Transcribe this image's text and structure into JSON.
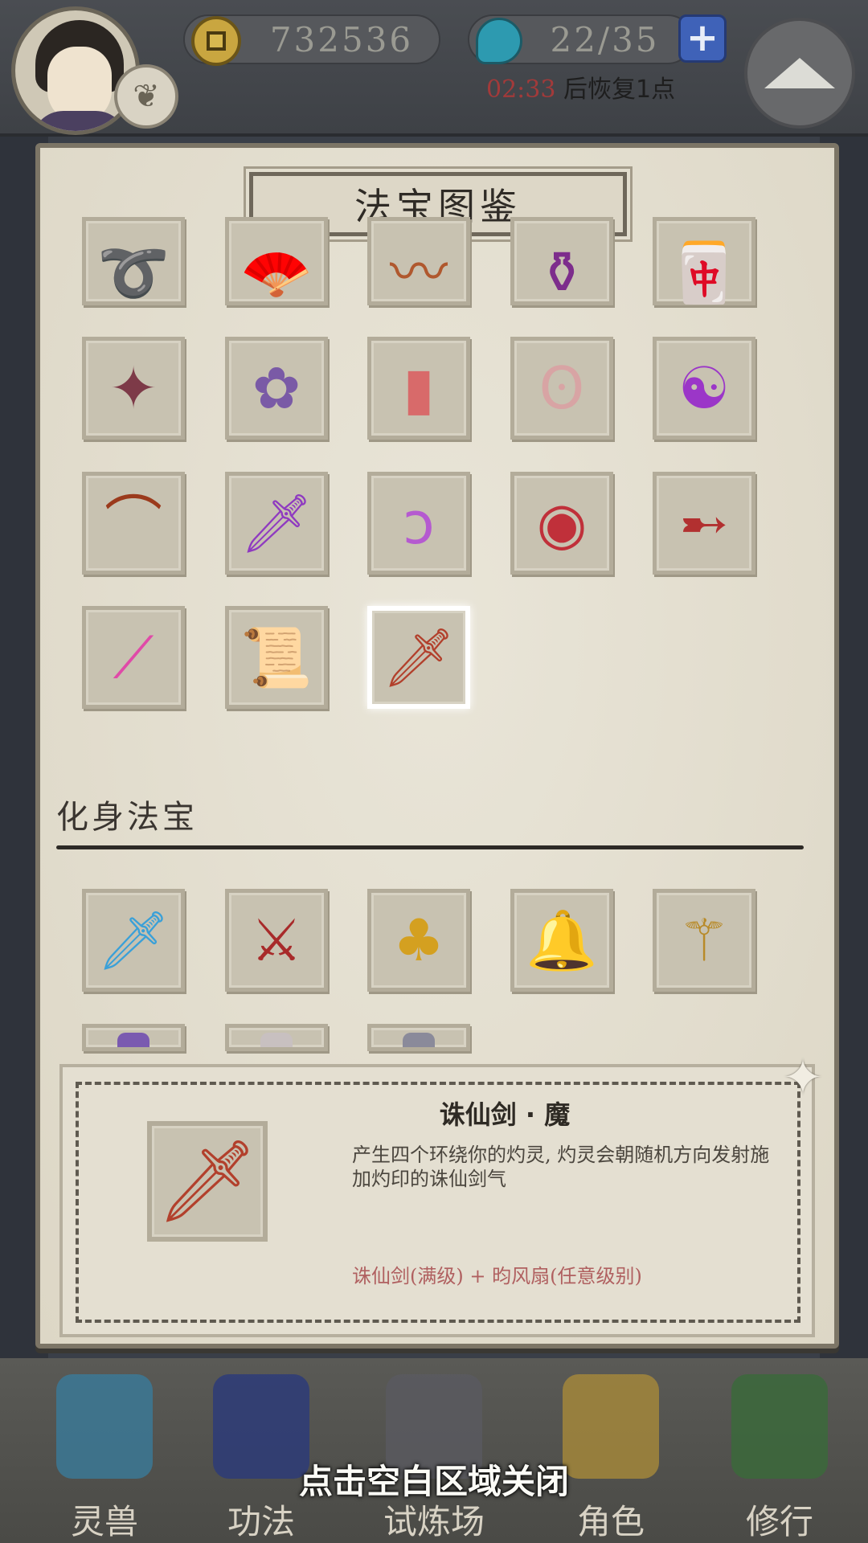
{
  "hud": {
    "gold": "732536",
    "stamina": "22/35",
    "recover_timer": "02:33",
    "recover_text": "后恢复1点",
    "plus_label": "+"
  },
  "panel": {
    "title": "法宝图鉴",
    "grid": [
      {
        "name": "紫色丝带",
        "glyph": "➰",
        "color": "#b04aa8"
      },
      {
        "name": "羽扇",
        "glyph": "🪭",
        "color": "#3f6cbf"
      },
      {
        "name": "竹笛",
        "glyph": "〰",
        "color": "#b0582e"
      },
      {
        "name": "紫葫芦瓶",
        "glyph": "⚱",
        "color": "#7d2d8c"
      },
      {
        "name": "符箓",
        "glyph": "🀄",
        "color": "#c2432e"
      },
      {
        "name": "飞镖",
        "glyph": "✦",
        "color": "#7d3a48"
      },
      {
        "name": "莲花",
        "glyph": "✿",
        "color": "#7a5aa6"
      },
      {
        "name": "红符",
        "glyph": "▮",
        "color": "#d86a6a"
      },
      {
        "name": "玉佩",
        "glyph": "ʘ",
        "color": "#d8a4a4"
      },
      {
        "name": "太极",
        "glyph": "☯",
        "color": "#9b36c8"
      },
      {
        "name": "弓",
        "glyph": "⌒",
        "color": "#9b3a1c"
      },
      {
        "name": "紫剑",
        "glyph": "🗡",
        "color": "#8f3ac0"
      },
      {
        "name": "拂尘",
        "glyph": "ↄ",
        "color": "#b55ad0"
      },
      {
        "name": "戒指",
        "glyph": "◉",
        "color": "#c0303a"
      },
      {
        "name": "短刃",
        "glyph": "➸",
        "color": "#b23030"
      },
      {
        "name": "火把",
        "glyph": "⟋",
        "color": "#e04aa8"
      },
      {
        "name": "卷轴",
        "glyph": "📜",
        "color": "#d03a24"
      },
      {
        "name": "诛仙剑",
        "glyph": "🗡",
        "color": "#b2402c"
      }
    ],
    "section_title": "化身法宝",
    "avatar_grid": [
      {
        "name": "冰剑",
        "glyph": "🗡",
        "color": "#3aa0d8"
      },
      {
        "name": "血刃",
        "glyph": "⚔",
        "color": "#a82a2a"
      },
      {
        "name": "金葫芦",
        "glyph": "♣",
        "color": "#d4a020"
      },
      {
        "name": "金铃",
        "glyph": "🔔",
        "color": "#b8a040"
      },
      {
        "name": "金杖",
        "glyph": "⚚",
        "color": "#b88a28"
      }
    ],
    "avatar_grid_partial": [
      {
        "name": "紫物",
        "color": "#7a5ab0"
      },
      {
        "name": "面具",
        "color": "#c8c0c0"
      },
      {
        "name": "尖刺",
        "color": "#8a8a9a"
      }
    ],
    "detail": {
      "name": "诛仙剑 · 魔",
      "description": "产生四个环绕你的灼灵, 灼灵会朝随机方向发射施加灼印的诛仙剑气",
      "recipe": "诛仙剑(满级) + 昀风扇(任意级别)",
      "icon_glyph": "🗡",
      "icon_color": "#b2402c"
    }
  },
  "bottom_nav": {
    "items": [
      {
        "label": "灵兽",
        "color": "#3a7a9a"
      },
      {
        "label": "功法",
        "color": "#2a3a7a"
      },
      {
        "label": "试炼场",
        "color": "#5a5a60"
      },
      {
        "label": "角色",
        "color": "#a88a3a"
      },
      {
        "label": "修行",
        "color": "#3a6a3a"
      }
    ]
  },
  "close_hint": "点击空白区域关闭"
}
